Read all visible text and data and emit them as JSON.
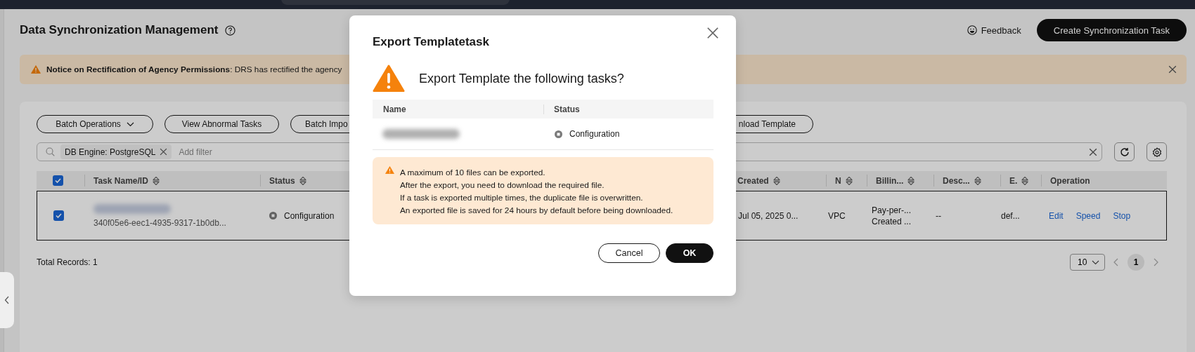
{
  "page": {
    "title": "Data Synchronization Management",
    "feedback": "Feedback",
    "create_button": "Create Synchronization Task"
  },
  "notice": {
    "text": "**Notice on Rectification of Agency Permissions**: DRS has rectified the agency"
  },
  "toolbar": {
    "buttons": [
      {
        "label": "Batch Operations",
        "kind": "dropdown"
      },
      {
        "label": "View Abnormal Tasks",
        "kind": "plain"
      },
      {
        "label": "Batch Impo",
        "kind": "plain"
      },
      {
        "label": "nload Template",
        "kind": "plain"
      }
    ]
  },
  "filter": {
    "tags": [
      {
        "label": "DB Engine: PostgreSQL"
      }
    ],
    "placeholder": "Add filter"
  },
  "table": {
    "all_checked": true,
    "columns": [
      {
        "label": "Task Name/ID",
        "sortable": true
      },
      {
        "label": "Status",
        "sortable": true
      },
      {
        "label": "Created",
        "sortable": true
      },
      {
        "label": "N",
        "sortable": true
      },
      {
        "label": "Billin...",
        "sortable": true
      },
      {
        "label": "Desc...",
        "sortable": true
      },
      {
        "label": "E.",
        "sortable": true
      },
      {
        "label": "Operation",
        "sortable": false
      }
    ],
    "rows": [
      {
        "checked": true,
        "selected": true,
        "id": "340f05e6-eec1-4935-9317-1b0db...",
        "status": "Configuration",
        "created": "Jul 05, 2025 0...",
        "n": "VPC",
        "billing": [
          "Pay-per-...",
          "Created ..."
        ],
        "description": "--",
        "e": "def...",
        "operations": [
          "Edit",
          "Speed",
          "Stop"
        ]
      }
    ]
  },
  "footer": {
    "total": "Total Records: 1",
    "page_size": "10",
    "pages": [
      {
        "label": "1",
        "selected": true
      }
    ]
  },
  "dialog": {
    "title": "Export Templatetask",
    "question": "Export Template the following tasks?",
    "columns": [
      "Name",
      "Status"
    ],
    "rows": [
      {
        "status": "Configuration"
      }
    ],
    "notice_lines": [
      "A maximum of 10 files can be exported.",
      "After the export, you need to download the required file.",
      "If a task is exported multiple times, the duplicate file is overwritten.",
      "An exported file is saved for 24 hours by default before being downloaded."
    ],
    "buttons": [
      {
        "label": "Cancel",
        "kind": "secondary"
      },
      {
        "label": "OK",
        "kind": "primary"
      }
    ]
  }
}
